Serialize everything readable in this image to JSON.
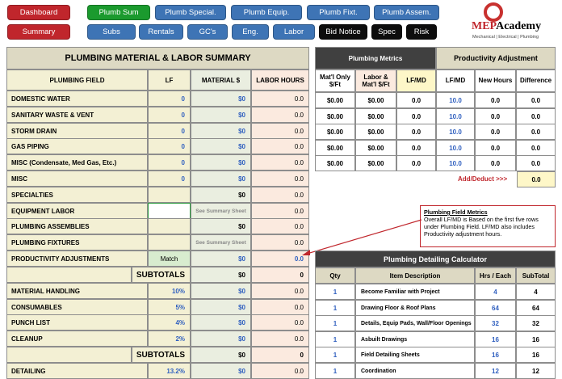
{
  "nav": {
    "dashboard": "Dashboard",
    "summary": "Summary",
    "plumb_sum": "Plumb Sum",
    "plumb_special": "Plumb Special.",
    "plumb_equip": "Plumb Equip.",
    "plumb_fixt": "Plumb Fixt.",
    "plumb_assem": "Plumb Assem.",
    "subs": "Subs",
    "rentals": "Rentals",
    "gcs": "GC's",
    "eng": "Eng.",
    "labor": "Labor",
    "bid_notice": "Bid Notice",
    "spec": "Spec",
    "risk": "Risk"
  },
  "logo": {
    "mep": "MEP",
    "academy": "Academy",
    "tagline": "Mechanical | Electrical | Plumbing"
  },
  "summary": {
    "title": "PLUMBING MATERIAL & LABOR SUMMARY",
    "headers": [
      "PLUMBING FIELD",
      "LF",
      "MATERIAL $",
      "LABOR HOURS"
    ],
    "rows": [
      {
        "label": "DOMESTIC WATER",
        "lf": "0",
        "mat": "$0",
        "hrs": "0.0"
      },
      {
        "label": "SANITARY WASTE & VENT",
        "lf": "0",
        "mat": "$0",
        "hrs": "0.0"
      },
      {
        "label": "STORM DRAIN",
        "lf": "0",
        "mat": "$0",
        "hrs": "0.0"
      },
      {
        "label": "GAS PIPING",
        "lf": "0",
        "mat": "$0",
        "hrs": "0.0"
      },
      {
        "label": "MISC (Condensate, Med Gas, Etc.)",
        "lf": "0",
        "mat": "$0",
        "hrs": "0.0"
      },
      {
        "label": "MISC",
        "lf": "0",
        "mat": "$0",
        "hrs": "0.0"
      },
      {
        "label": "SPECIALTIES",
        "lf": "",
        "mat": "$0",
        "hrs": "0.0"
      },
      {
        "label": "EQUIPMENT LABOR",
        "lf": "",
        "mat": "See Summary Sheet",
        "hrs": "0.0"
      },
      {
        "label": "PLUMBING ASSEMBLIES",
        "lf": "",
        "mat": "$0",
        "hrs": "0.0"
      },
      {
        "label": "PLUMBING FIXTURES",
        "lf": "",
        "mat": "See Summary Sheet",
        "hrs": "0.0"
      },
      {
        "label": "PRODUCTIVITY ADJUSTMENTS",
        "lf": "Match",
        "mat": "$0",
        "hrs": "0.0"
      }
    ],
    "subtotal1": {
      "label": "SUBTOTALS",
      "mat": "$0",
      "hrs": "0"
    },
    "rows2": [
      {
        "label": "MATERIAL HANDLING",
        "pct": "10%",
        "mat": "$0",
        "hrs": "0.0"
      },
      {
        "label": "CONSUMABLES",
        "pct": "5%",
        "mat": "$0",
        "hrs": "0.0"
      },
      {
        "label": "PUNCH LIST",
        "pct": "4%",
        "mat": "$0",
        "hrs": "0.0"
      },
      {
        "label": "CLEANUP",
        "pct": "2%",
        "mat": "$0",
        "hrs": "0.0"
      }
    ],
    "subtotal2": {
      "label": "SUBTOTALS",
      "mat": "$0",
      "hrs": "0"
    },
    "detailing": {
      "label": "DETAILING",
      "pct": "13.2%",
      "mat": "$0",
      "hrs": "0.0"
    }
  },
  "metrics": {
    "title": "Plumbing Metrics",
    "prod_title": "Productivity Adjustment",
    "headers": [
      "Mat'l Only $/Ft",
      "Labor & Mat'l $/Ft",
      "LF/MD",
      "LF/MD",
      "New Hours",
      "Difference"
    ],
    "rows": [
      [
        "$0.00",
        "$0.00",
        "0.0",
        "10.0",
        "0.0",
        "0.0"
      ],
      [
        "$0.00",
        "$0.00",
        "0.0",
        "10.0",
        "0.0",
        "0.0"
      ],
      [
        "$0.00",
        "$0.00",
        "0.0",
        "10.0",
        "0.0",
        "0.0"
      ],
      [
        "$0.00",
        "$0.00",
        "0.0",
        "10.0",
        "0.0",
        "0.0"
      ],
      [
        "$0.00",
        "$0.00",
        "0.0",
        "10.0",
        "0.0",
        "0.0"
      ]
    ],
    "add_deduct_label": "Add/Deduct >>>",
    "add_deduct_value": "0.0"
  },
  "note": {
    "title": "Plumbing Field Metrics",
    "text": "Overall LF/MD is Based on the first five rows under Plumbing Field. LF/MD also includes Productivity adjustment hours."
  },
  "calculator": {
    "title": "Plumbing Detailing Calculator",
    "headers": [
      "Qty",
      "Item Description",
      "Hrs / Each",
      "SubTotal"
    ],
    "rows": [
      {
        "qty": "1",
        "desc": "Become Familiar with Project",
        "hrs": "4",
        "sub": "4"
      },
      {
        "qty": "1",
        "desc": "Drawing Floor & Roof Plans",
        "hrs": "64",
        "sub": "64"
      },
      {
        "qty": "1",
        "desc": "Details, Equip Pads, Wall/Floor Openings",
        "hrs": "32",
        "sub": "32"
      },
      {
        "qty": "1",
        "desc": "Asbuilt Drawings",
        "hrs": "16",
        "sub": "16"
      },
      {
        "qty": "1",
        "desc": "Field Detailing Sheets",
        "hrs": "16",
        "sub": "16"
      },
      {
        "qty": "1",
        "desc": "Coordination",
        "hrs": "12",
        "sub": "12"
      }
    ]
  },
  "colors": {
    "accent_red": "#c0262c",
    "nav_green": "#1b9a2e",
    "nav_blue": "#3e74b5",
    "value_blue": "#2f5fbf"
  }
}
